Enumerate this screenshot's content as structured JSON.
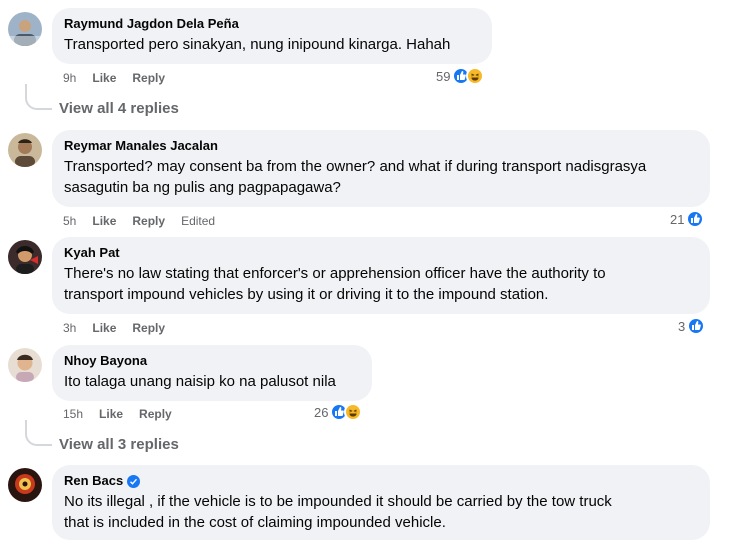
{
  "comments": [
    {
      "author": "Raymund Jagdon Dela Peña",
      "text": "Transported pero sinakyan, nung inipound kinarga. Hahah",
      "time": "9h",
      "like": "Like",
      "reply": "Reply",
      "reactions": "59",
      "reaction_icons": [
        "like-icon",
        "haha-icon"
      ],
      "view_replies": "View all 4 replies"
    },
    {
      "author": "Reymar Manales Jacalan",
      "text": "Transported? may consent ba from the owner? and what if during transport nadisgrasya\nsasagutin ba ng pulis ang pagpapagawa?",
      "time": "5h",
      "like": "Like",
      "reply": "Reply",
      "edited": "Edited",
      "reactions": "21",
      "reaction_icons": [
        "like-icon"
      ]
    },
    {
      "author": "Kyah Pat",
      "text": "There's no law stating that enforcer's or apprehension officer have the authority to\ntransport impound vehicles by using it or driving it to the impound station.",
      "time": "3h",
      "like": "Like",
      "reply": "Reply",
      "reactions": "3",
      "reaction_icons": [
        "like-icon"
      ]
    },
    {
      "author": "Nhoy Bayona",
      "text": "Ito talaga unang naisip ko na palusot nila",
      "time": "15h",
      "like": "Like",
      "reply": "Reply",
      "reactions": "26",
      "reaction_icons": [
        "like-icon",
        "haha-icon"
      ],
      "view_replies": "View all 3 replies"
    },
    {
      "author": "Ren Bacs",
      "verified": true,
      "text": "No its illegal , if the vehicle is to be impounded it should be carried by the tow truck\nthat is included in the cost of claiming impounded vehicle."
    }
  ],
  "colors": {
    "bubble": "#f0f2f5",
    "meta": "#65676b",
    "like_blue": "#1877f2",
    "haha_yellow": "#f7b928"
  }
}
